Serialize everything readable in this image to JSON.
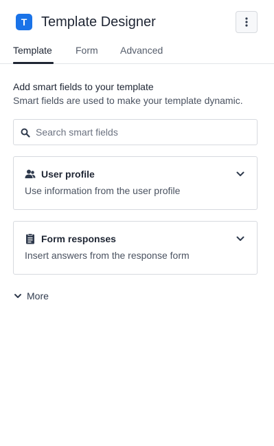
{
  "app": {
    "logo_letter": "T",
    "title": "Template Designer",
    "brand_color": "#1a73e8"
  },
  "tabs": [
    {
      "label": "Template",
      "active": true
    },
    {
      "label": "Form",
      "active": false
    },
    {
      "label": "Advanced",
      "active": false
    }
  ],
  "intro": {
    "title": "Add smart fields to your template",
    "subtitle": "Smart fields are used to make your template dynamic."
  },
  "search": {
    "placeholder": "Search smart fields",
    "value": ""
  },
  "cards": [
    {
      "icon": "users-icon",
      "title": "User profile",
      "description": "Use information from the user profile"
    },
    {
      "icon": "clipboard-icon",
      "title": "Form responses",
      "description": "Insert answers from the response form"
    }
  ],
  "more": {
    "label": "More"
  }
}
